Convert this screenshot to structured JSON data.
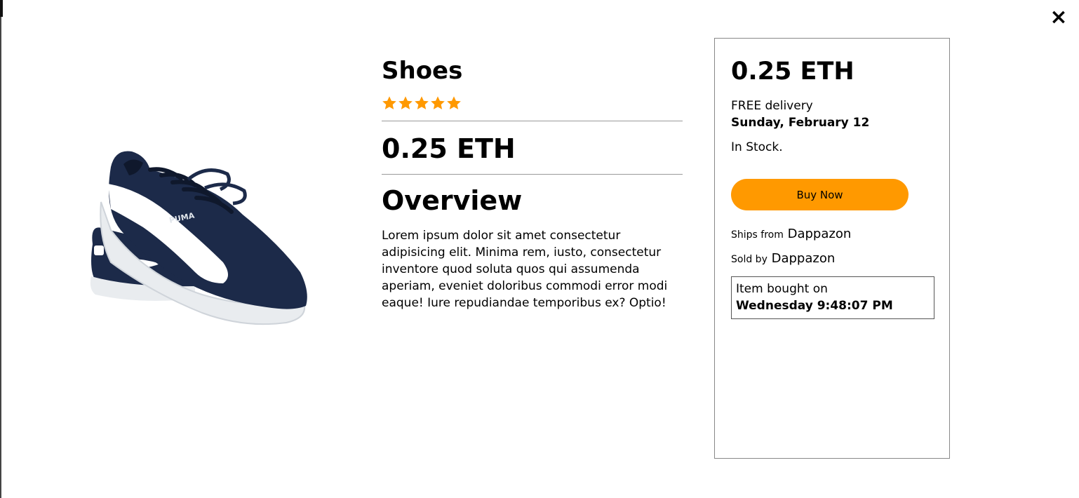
{
  "close_label": "×",
  "product": {
    "title": "Shoes",
    "rating_stars": 5,
    "rating_max": 5,
    "price": "0.25 ETH",
    "overview_heading": "Overview",
    "description": "Lorem ipsum dolor sit amet consectetur adipisicing elit. Minima rem, iusto, consectetur inventore quod soluta quos qui assumenda aperiam, eveniet doloribus commodi error modi eaque! Iure repudiandae temporibus ex? Optio!"
  },
  "buy_box": {
    "price": "0.25 ETH",
    "delivery_label": "FREE delivery",
    "delivery_date": "Sunday, February 12",
    "stock_status": "In Stock.",
    "buy_button_label": "Buy Now",
    "ships_from_label": "Ships from",
    "ships_from_value": "Dappazon",
    "sold_by_label": "Sold by",
    "sold_by_value": "Dappazon",
    "bought_label": "Item bought on",
    "bought_date": "Wednesday 9:48:07 PM"
  },
  "colors": {
    "accent": "#ff9900",
    "star": "#ff9900",
    "shoe_body": "#1c2a49",
    "shoe_stripe": "#ffffff"
  },
  "icons": {
    "close": "close-icon",
    "star": "star-icon"
  }
}
